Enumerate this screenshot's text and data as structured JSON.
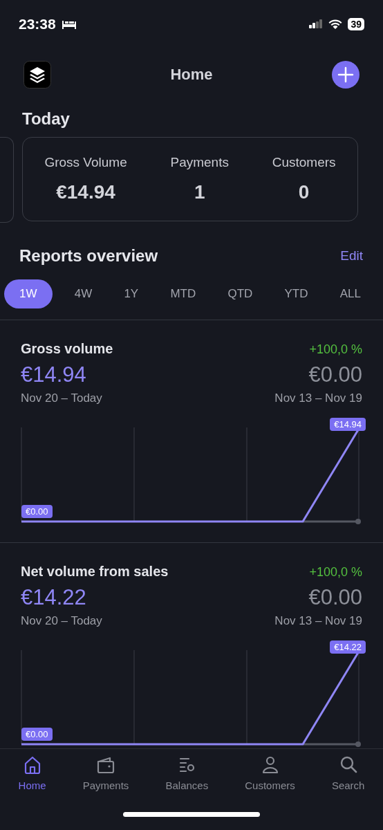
{
  "status_bar": {
    "time": "23:38",
    "battery": "39"
  },
  "header": {
    "title": "Home"
  },
  "today": {
    "title": "Today",
    "stats": [
      {
        "label": "Gross Volume",
        "value": "€14.94"
      },
      {
        "label": "Payments",
        "value": "1"
      },
      {
        "label": "Customers",
        "value": "0"
      }
    ]
  },
  "reports": {
    "title": "Reports overview",
    "edit": "Edit",
    "periods": [
      {
        "label": "1W",
        "selected": true
      },
      {
        "label": "4W",
        "selected": false
      },
      {
        "label": "1Y",
        "selected": false
      },
      {
        "label": "MTD",
        "selected": false
      },
      {
        "label": "QTD",
        "selected": false
      },
      {
        "label": "YTD",
        "selected": false
      },
      {
        "label": "ALL",
        "selected": false
      }
    ],
    "cards": [
      {
        "title": "Gross volume",
        "change": "+100,0 %",
        "value": "€14.94",
        "previous": "€0.00",
        "period": "Nov 20 – Today",
        "previous_period": "Nov 13 – Nov 19",
        "start_label": "€0.00",
        "end_label": "€14.94"
      },
      {
        "title": "Net volume from sales",
        "change": "+100,0 %",
        "value": "€14.22",
        "previous": "€0.00",
        "period": "Nov 20 – Today",
        "previous_period": "Nov 13 – Nov 19",
        "start_label": "€0.00",
        "end_label": "€14.22"
      }
    ]
  },
  "tab_bar": [
    {
      "label": "Home",
      "selected": true
    },
    {
      "label": "Payments",
      "selected": false
    },
    {
      "label": "Balances",
      "selected": false
    },
    {
      "label": "Customers",
      "selected": false
    },
    {
      "label": "Search",
      "selected": false
    }
  ]
}
